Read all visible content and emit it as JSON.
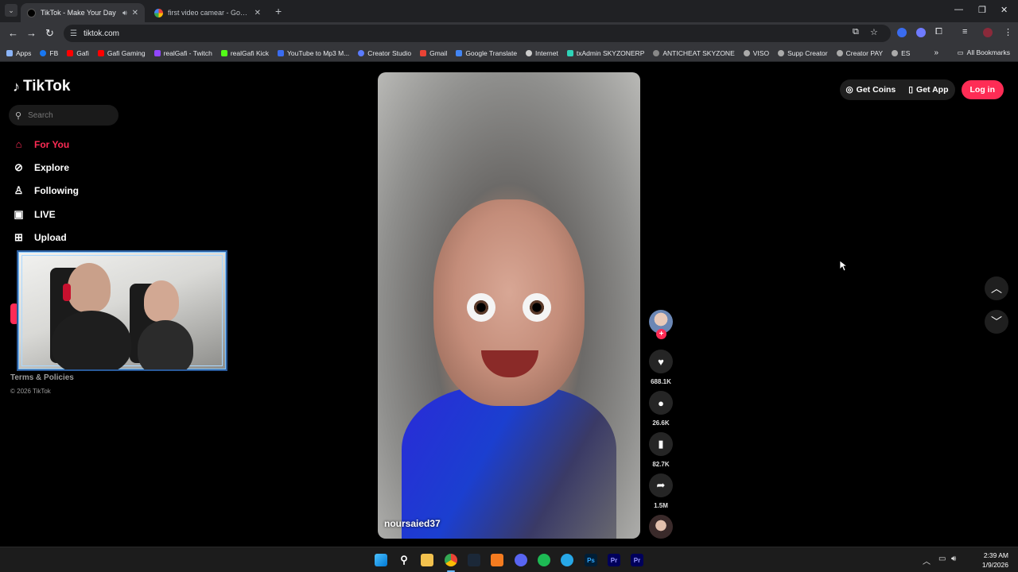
{
  "browser": {
    "tabs": [
      {
        "title": "TikTok - Make Your Day",
        "active": true
      },
      {
        "title": "first video camear - Google Sea",
        "active": false
      }
    ],
    "url": "tiktok.com",
    "bookmarks": [
      {
        "label": "Apps",
        "color": "#8ab4f8"
      },
      {
        "label": "FB",
        "color": "#1877f2"
      },
      {
        "label": "Gafi",
        "color": "#ff0000"
      },
      {
        "label": "Gafi Gaming",
        "color": "#ff0000"
      },
      {
        "label": "realGafi - Twitch",
        "color": "#9146ff"
      },
      {
        "label": "realGafi Kick",
        "color": "#53fc18"
      },
      {
        "label": "YouTube to Mp3 M...",
        "color": "#3a6cf0"
      },
      {
        "label": "Creator Studio",
        "color": "#5b7cff"
      },
      {
        "label": "Gmail",
        "color": "#ea4335"
      },
      {
        "label": "Google Translate",
        "color": "#4285f4"
      },
      {
        "label": "Internet",
        "color": "#cccccc"
      },
      {
        "label": "txAdmin SKYZONERP",
        "color": "#2ed3b7"
      },
      {
        "label": "ANTICHEAT SKYZONE",
        "color": "#888888"
      },
      {
        "label": "VISO",
        "color": "#aaaaaa"
      },
      {
        "label": "Supp Creator",
        "color": "#aaaaaa"
      },
      {
        "label": "Creator PAY",
        "color": "#aaaaaa"
      },
      {
        "label": "ES",
        "color": "#aaaaaa"
      }
    ],
    "all_bookmarks": "All Bookmarks"
  },
  "tiktok": {
    "logo": "TikTok",
    "search_placeholder": "Search",
    "nav": [
      {
        "label": "For You",
        "icon": "home-icon"
      },
      {
        "label": "Explore",
        "icon": "compass-icon"
      },
      {
        "label": "Following",
        "icon": "person-icon"
      },
      {
        "label": "LIVE",
        "icon": "live-tv-icon"
      },
      {
        "label": "Upload",
        "icon": "plus-square-icon"
      }
    ],
    "footer": {
      "terms": "Terms & Policies",
      "copyright": "© 2026 TikTok"
    },
    "top_right": {
      "get_coins": "Get Coins",
      "get_app": "Get App",
      "login": "Log in"
    },
    "video": {
      "username": "noursaied37",
      "likes": "688.1K",
      "comments": "26.6K",
      "saves": "82.7K",
      "shares": "1.5M"
    }
  },
  "taskbar": {
    "time": "2:39 AM",
    "date": "1/9/2026"
  },
  "colors": {
    "accent": "#fe2c55",
    "chrome_dark": "#202124",
    "chrome_toolbar": "#35363a"
  }
}
